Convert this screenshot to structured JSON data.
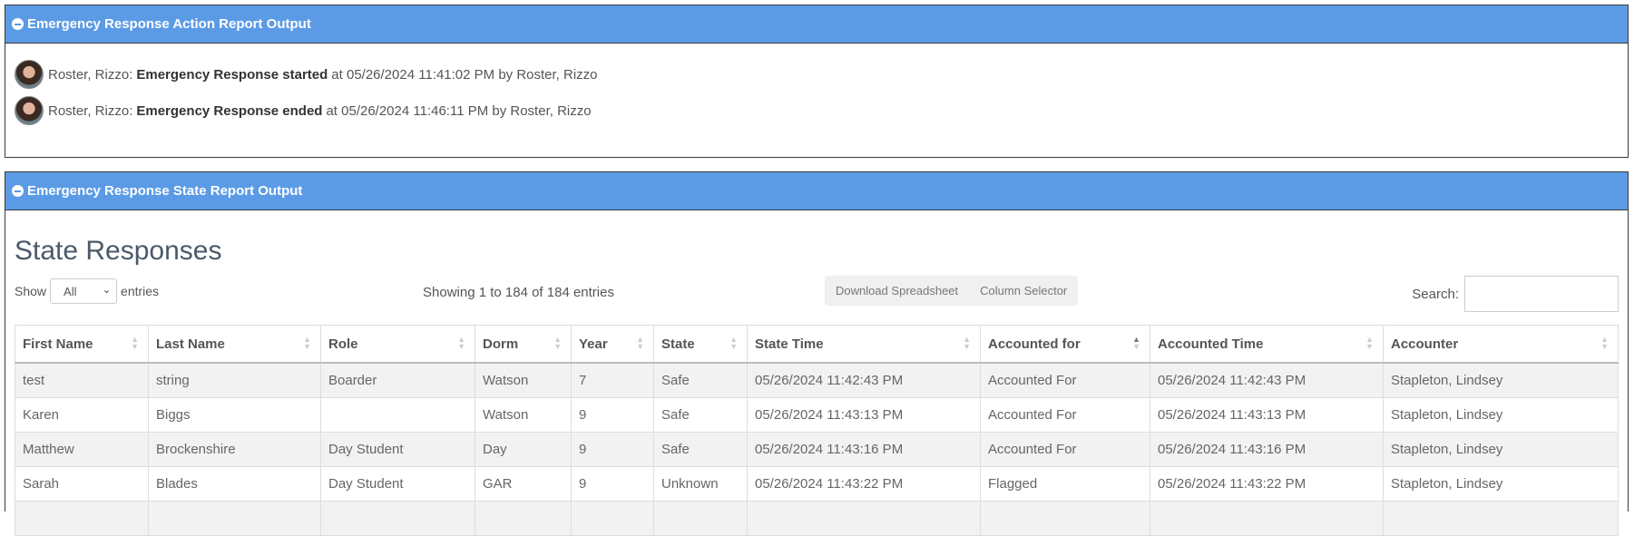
{
  "action_panel": {
    "title": "Emergency Response Action Report Output",
    "entries": [
      {
        "user": "Roster, Rizzo:",
        "event": "Emergency Response started",
        "detail": "at 05/26/2024 11:41:02 PM by Roster, Rizzo"
      },
      {
        "user": "Roster, Rizzo:",
        "event": "Emergency Response ended",
        "detail": "at 05/26/2024 11:46:11 PM by Roster, Rizzo"
      }
    ]
  },
  "state_panel": {
    "title": "Emergency Response State Report Output",
    "heading": "State Responses",
    "show_label": "Show",
    "show_value": "All",
    "entries_label": "entries",
    "info": "Showing 1 to 184 of 184 entries",
    "buttons": {
      "download": "Download Spreadsheet",
      "columns": "Column Selector"
    },
    "search_label": "Search:",
    "search_value": ""
  },
  "table": {
    "columns": [
      "First Name",
      "Last Name",
      "Role",
      "Dorm",
      "Year",
      "State",
      "State Time",
      "Accounted for",
      "Accounted Time",
      "Accounter"
    ],
    "sorted_column": "Accounted for",
    "rows": [
      [
        "test",
        "string",
        "Boarder",
        "Watson",
        "7",
        "Safe",
        "05/26/2024 11:42:43 PM",
        "Accounted For",
        "05/26/2024 11:42:43 PM",
        "Stapleton, Lindsey"
      ],
      [
        "Karen",
        "Biggs",
        "",
        "Watson",
        "9",
        "Safe",
        "05/26/2024 11:43:13 PM",
        "Accounted For",
        "05/26/2024 11:43:13 PM",
        "Stapleton, Lindsey"
      ],
      [
        "Matthew",
        "Brockenshire",
        "Day Student",
        "Day",
        "9",
        "Safe",
        "05/26/2024 11:43:16 PM",
        "Accounted For",
        "05/26/2024 11:43:16 PM",
        "Stapleton, Lindsey"
      ],
      [
        "Sarah",
        "Blades",
        "Day Student",
        "GAR",
        "9",
        "Unknown",
        "05/26/2024 11:43:22 PM",
        "Flagged",
        "05/26/2024 11:43:22 PM",
        "Stapleton, Lindsey"
      ]
    ]
  },
  "colors": {
    "header_bg": "#5b9be6",
    "stripe": "#f2f2f2"
  }
}
